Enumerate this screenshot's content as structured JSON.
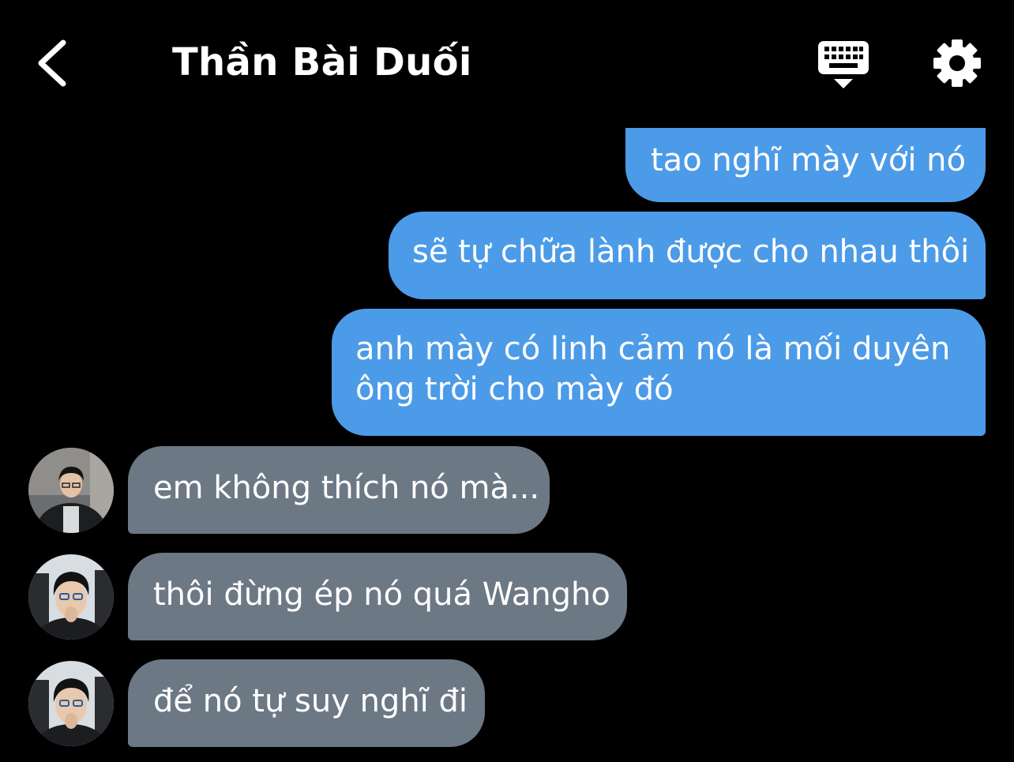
{
  "header": {
    "title": "Thần Bài Duối",
    "back_icon": "chevron-left-icon",
    "keyboard_icon": "keyboard-icon",
    "settings_icon": "gear-icon"
  },
  "colors": {
    "background": "#000000",
    "outgoing_bubble": "#4c9be8",
    "incoming_bubble": "#6d7885",
    "text": "#ffffff"
  },
  "messages": [
    {
      "direction": "outgoing",
      "text": "tao nghĩ mày với nó"
    },
    {
      "direction": "outgoing",
      "text": "sẽ tự chữa lành được cho nhau thôi"
    },
    {
      "direction": "outgoing",
      "text": "anh mày có linh cảm nó là mối duyên ông trời cho mày đó"
    },
    {
      "direction": "incoming",
      "text": "em không thích nó mà..."
    },
    {
      "direction": "incoming",
      "text": "thôi đừng ép nó quá Wangho"
    },
    {
      "direction": "incoming",
      "text": "để nó tự suy nghĩ đi"
    }
  ]
}
